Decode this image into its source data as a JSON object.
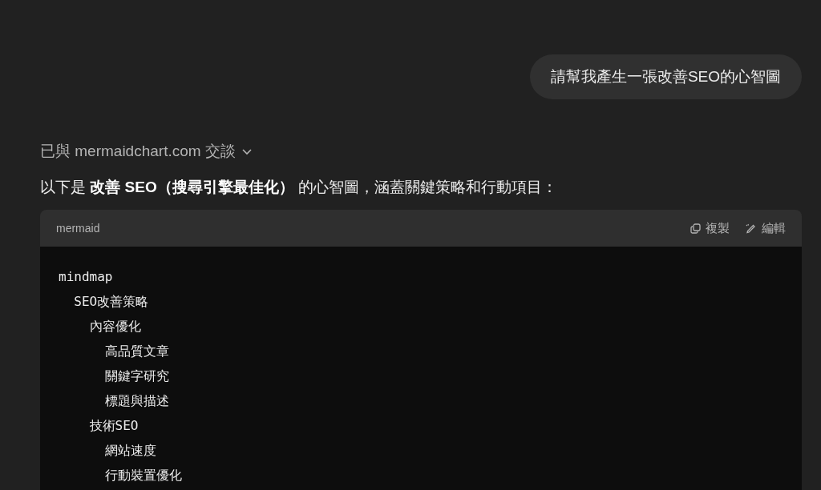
{
  "user_message": "請幫我產生一張改善SEO的心智圖",
  "tool_note": {
    "text": "已與 mermaidchart.com 交談",
    "expanded": false
  },
  "reply_intro": "以下是 **改善 SEO（搜尋引擎最佳化）** 的心智圖，涵蓋關鍵策略和行動項目：",
  "code_block": {
    "language": "mermaid",
    "actions": [
      {
        "kind": "copy",
        "label": "複製"
      },
      {
        "kind": "edit",
        "label": "編輯"
      }
    ],
    "lines": [
      "mindmap",
      "  SEO改善策略",
      "    內容優化",
      "      高品質文章",
      "      關鍵字研究",
      "      標題與描述",
      "    技術SEO",
      "      網站速度",
      "      行動裝置優化"
    ]
  }
}
